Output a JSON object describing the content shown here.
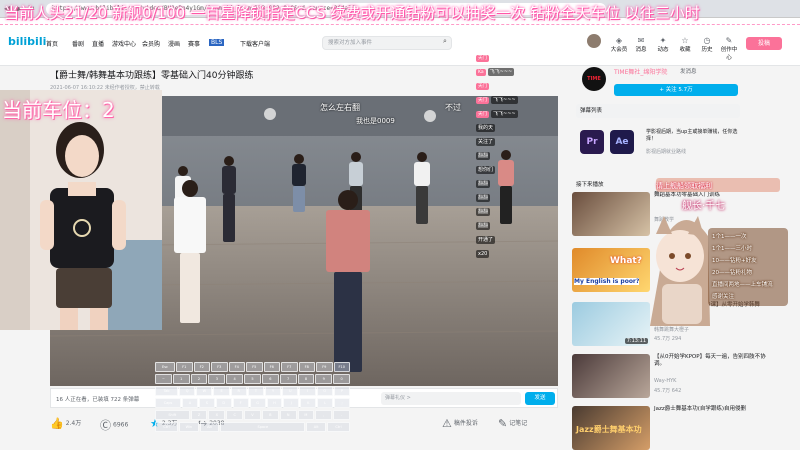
{
  "banner": {
    "text": "当前人头21/20  新舰0/100  一百星降锁指定CCS  续费或开通钻粉可以抽奖一次  钻粉全天车位  以往三小时",
    "car_position": "当前车位：2"
  },
  "browser": {
    "url": "https://www.bilibili.com/video/BV1eBn4y1Gm/?spm_id_from=333.999.0.0&vd_source=2f4a7f"
  },
  "header": {
    "logo": "bilibili",
    "nav": [
      "首页",
      "番剧",
      "直播",
      "游戏中心",
      "会员购",
      "漫画",
      "赛事",
      "BLS",
      "下载客户端"
    ],
    "search_placeholder": "搜索对方加入事件",
    "icons": [
      {
        "label": "大会员",
        "icon": "vip-icon"
      },
      {
        "label": "消息",
        "icon": "message-icon"
      },
      {
        "label": "动态",
        "icon": "dynamic-icon"
      },
      {
        "label": "收藏",
        "icon": "favorite-icon"
      },
      {
        "label": "历史",
        "icon": "history-icon"
      },
      {
        "label": "创作中心",
        "icon": "creator-icon"
      }
    ],
    "upload": "投稿"
  },
  "video": {
    "title": "【爵士舞/韩舞基本功跟练】零基础入门40分钟跟练",
    "meta": "2021-06-07 16:10:22  未经作者授权，禁止转载",
    "viewers": "16 人正在看，已装填 722 条弹幕",
    "danmaku_placeholder": "弹幕礼仪 >",
    "send": "发送",
    "overlay_text_1": "怎么左右翻",
    "overlay_text_2": "我也是0009",
    "overlay_text_3": "不过"
  },
  "actions": [
    {
      "label": "2.4万",
      "icon": "like-icon"
    },
    {
      "label": "6966",
      "icon": "coin-icon"
    },
    {
      "label": "2.3万",
      "icon": "star-icon"
    },
    {
      "label": "2038",
      "icon": "share-icon"
    },
    {
      "label": "稿件投诉",
      "icon": "report-icon"
    },
    {
      "label": "记笔记",
      "icon": "note-icon"
    }
  ],
  "uploader": {
    "name": "TIME舞社_绵阳学院",
    "message": "发消息",
    "follow": "+ 关注 5.7万"
  },
  "sidebar": {
    "danmu_list": "弹幕列表",
    "ad_text": "学影视后期，当up主或接单赚钱，任你选择！",
    "ad_sub": "影视后期就业路线",
    "next": "接下来播放",
    "recs": [
      {
        "title": "舞蹈基本功零基础入门训练",
        "user": "舞蹈教学",
        "stats": "",
        "duration": ""
      },
      {
        "title": "What? My English is poor?",
        "user": "",
        "stats": "",
        "duration": ""
      },
      {
        "title": "【新手入门女团舞全28课】从零开始学韩舞(女团舞基本功)",
        "user": "韩舞跳舞大橙子",
        "stats": "45.7万  294",
        "duration": "7:13:11"
      },
      {
        "title": "【从0开始学KPOP】每天一遍，告别四肢不协调。",
        "user": "Way-HYK",
        "stats": "45.7万  642",
        "duration": ""
      },
      {
        "title": "Jazz爵士舞基本功(自学跟练)自用侵删",
        "user": "",
        "stats": "",
        "duration": ""
      }
    ]
  },
  "chat": [
    {
      "badge": "天门",
      "msg": ""
    },
    {
      "badge": "Ka",
      "msg": "飞飞~~~"
    },
    {
      "badge": "天门",
      "msg": ""
    },
    {
      "badge": "天门",
      "msg": "飞飞~~~"
    },
    {
      "badge": "天门",
      "msg": "飞飞~~~"
    },
    {
      "badge": "",
      "msg": "我的天"
    },
    {
      "badge": "",
      "msg": "关注了"
    },
    {
      "badge": "",
      "msg": "翻翻"
    },
    {
      "badge": "",
      "msg": "想你们"
    },
    {
      "badge": "",
      "msg": "翻翻"
    },
    {
      "badge": "",
      "msg": "翻翻"
    },
    {
      "badge": "",
      "msg": "翻翻"
    },
    {
      "badge": "",
      "msg": "翻翻"
    },
    {
      "badge": "",
      "msg": "开通了"
    },
    {
      "badge": "",
      "msg": "x20"
    }
  ],
  "mascot": {
    "title": "请上舰船领取福利",
    "name": "舰长·千七",
    "lines": [
      "1个1——一次",
      "1个1——三小时",
      "10——钻粉+好友",
      "20——钻粉礼物",
      "直播间两地——上车铺流",
      "感谢关注"
    ]
  },
  "keyboard": {
    "rows": [
      [
        "Esc",
        "F1",
        "F2",
        "F3",
        "F4",
        "F5",
        "F6",
        "F7",
        "F8",
        "F9",
        "F10"
      ],
      [
        "~",
        "1",
        "2",
        "3",
        "4",
        "5",
        "6",
        "7",
        "8",
        "9",
        "0"
      ],
      [
        "Tab",
        "Q",
        "W",
        "E",
        "R",
        "T",
        "Y",
        "U",
        "I",
        "O",
        "P"
      ],
      [
        "Caps",
        "A",
        "S",
        "D",
        "F",
        "G",
        "H",
        "J",
        "K",
        "L",
        ";"
      ],
      [
        "Shift",
        "Z",
        "X",
        "C",
        "V",
        "B",
        "N",
        "M",
        ",",
        "."
      ],
      [
        "Ctrl",
        "Win",
        "Alt",
        "Space",
        "Alt",
        "Ctrl"
      ]
    ]
  },
  "colors": {
    "pink": "#fb7299",
    "blue": "#00aeec",
    "text": "#18191c"
  }
}
